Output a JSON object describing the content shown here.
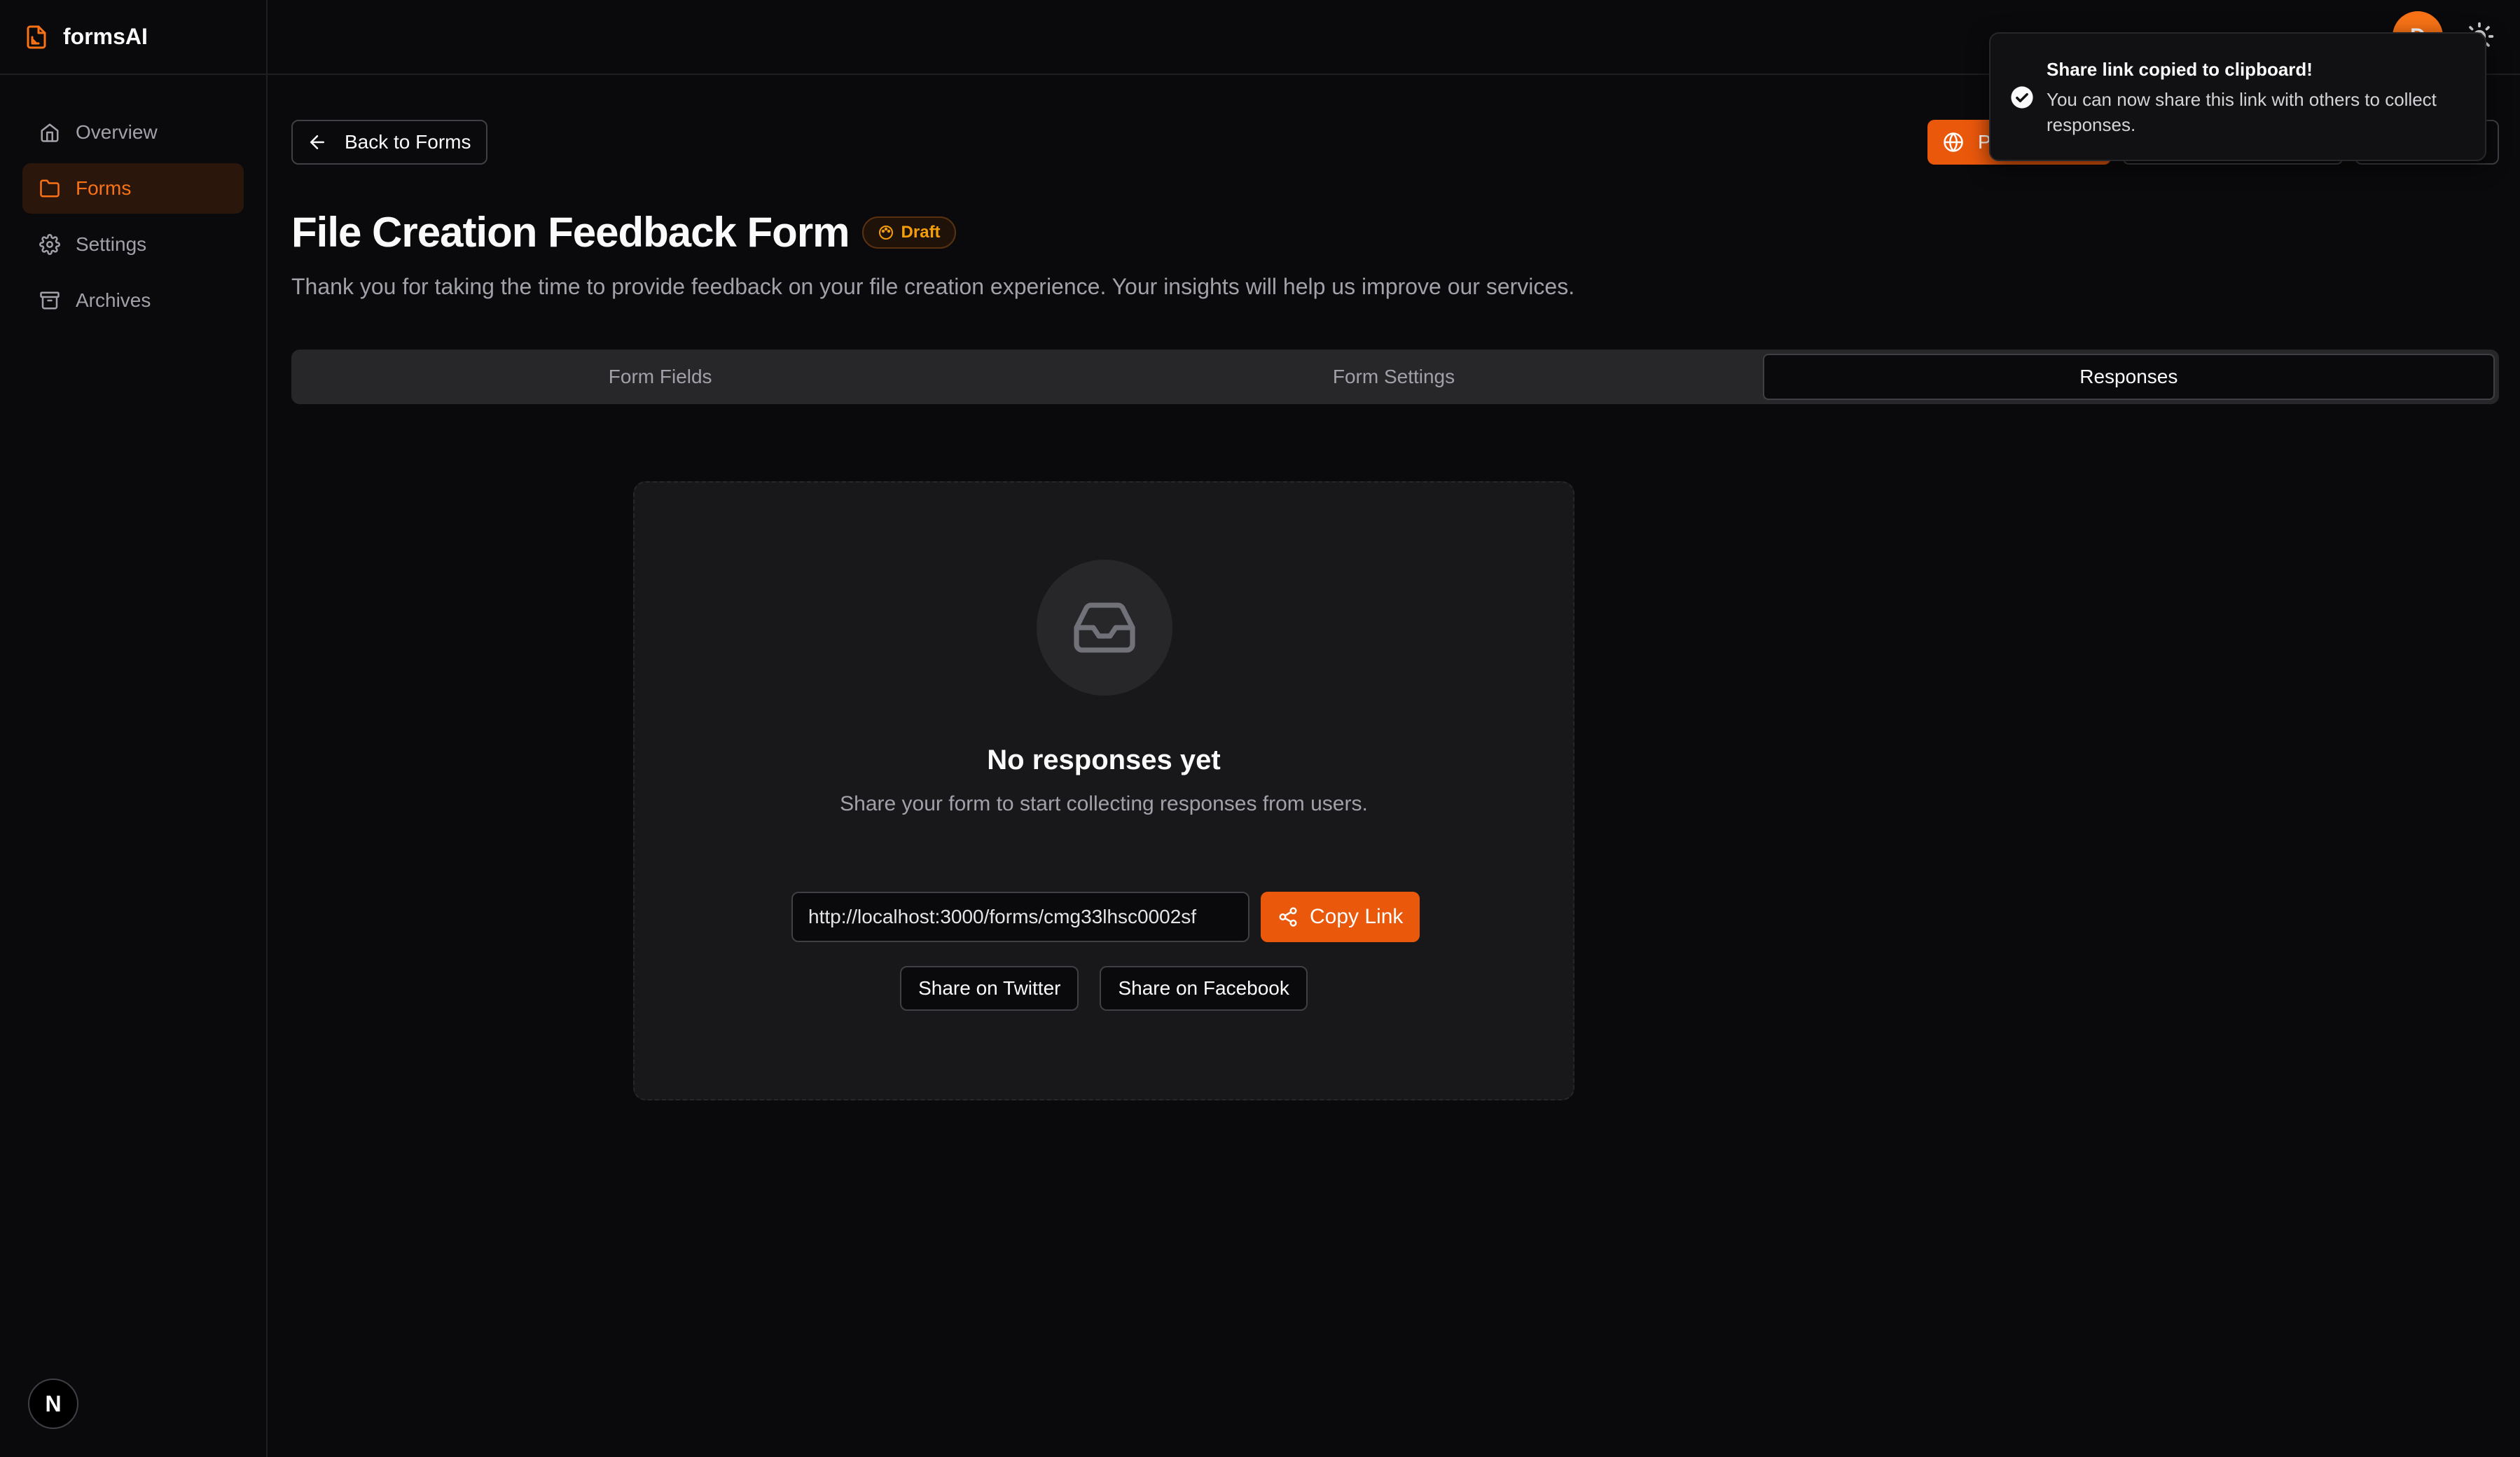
{
  "app": {
    "name": "formsAI",
    "avatar_letter": "D"
  },
  "sidebar": {
    "items": [
      {
        "label": "Overview",
        "icon": "home-icon"
      },
      {
        "label": "Forms",
        "icon": "folder-icon",
        "active": true
      },
      {
        "label": "Settings",
        "icon": "gear-icon"
      },
      {
        "label": "Archives",
        "icon": "archive-icon"
      }
    ],
    "bottom_badge": "N"
  },
  "header": {
    "back_label": "Back to Forms",
    "publish_label": "Publish"
  },
  "form": {
    "title": "File Creation Feedback Form",
    "status": "Draft",
    "description": "Thank you for taking the time to provide feedback on your file creation experience. Your insights will help us improve our services."
  },
  "tabs": [
    {
      "label": "Form Fields"
    },
    {
      "label": "Form Settings"
    },
    {
      "label": "Responses",
      "active": true
    }
  ],
  "empty_state": {
    "title": "No responses yet",
    "subtitle": "Share your form to start collecting responses from users.",
    "share_url": "http://localhost:3000/forms/cmg33lhsc0002sf",
    "copy_label": "Copy Link",
    "twitter_label": "Share on Twitter",
    "facebook_label": "Share on Facebook"
  },
  "toast": {
    "title": "Share link copied to clipboard!",
    "body": "You can now share this link with others to collect responses."
  },
  "colors": {
    "accent": "#ea580c",
    "background": "#0a0a0c",
    "card": "#18181b"
  }
}
